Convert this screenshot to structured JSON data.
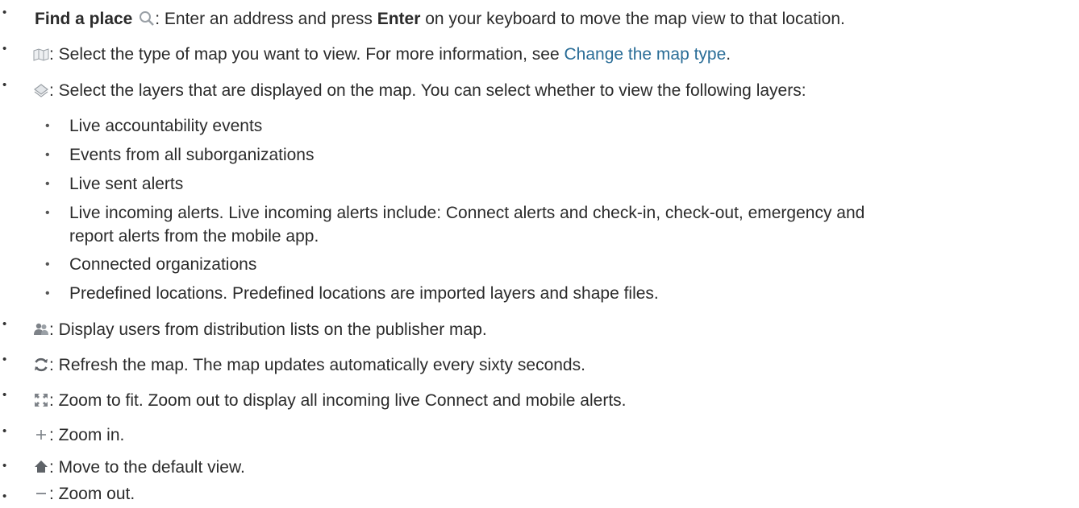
{
  "items": [
    {
      "bold": "Find a place",
      "icon": "search-icon",
      "text_pre": ": Enter an address and press ",
      "bold2": "Enter",
      "text_post": " on your keyboard to move the map view to that location."
    },
    {
      "icon": "map-type-icon",
      "text_pre": ": Select the type of map you want to view. For more information, see ",
      "link": "Change the map type",
      "text_post": "."
    },
    {
      "icon": "layers-icon",
      "text": ": Select the layers that are displayed on the map. You can select whether to view the following layers:"
    },
    {
      "icon": "users-icon",
      "text": ": Display users from distribution lists on the publisher map."
    },
    {
      "icon": "refresh-icon",
      "text": ": Refresh the map. The map updates automatically every sixty seconds."
    },
    {
      "icon": "zoom-to-fit-icon",
      "text": ": Zoom to fit. Zoom out to display all incoming live Connect and mobile alerts."
    },
    {
      "icon": "zoom-in-icon",
      "text": ": Zoom in."
    },
    {
      "icon": "home-icon",
      "text": ": Move to the default view."
    },
    {
      "icon": "zoom-out-icon",
      "text": ": Zoom out."
    }
  ],
  "layers": [
    "Live accountability events",
    "Events from all suborganizations",
    "Live sent alerts",
    "Live incoming alerts. Live incoming alerts include: Connect alerts and check-in, check-out, emergency and",
    "report alerts from the mobile app.",
    "Connected organizations",
    "Predefined locations. Predefined locations are imported layers and shape files."
  ],
  "colors": {
    "text": "#2b2b2b",
    "link": "#2a6d97",
    "icon": "#9aa0a6"
  }
}
